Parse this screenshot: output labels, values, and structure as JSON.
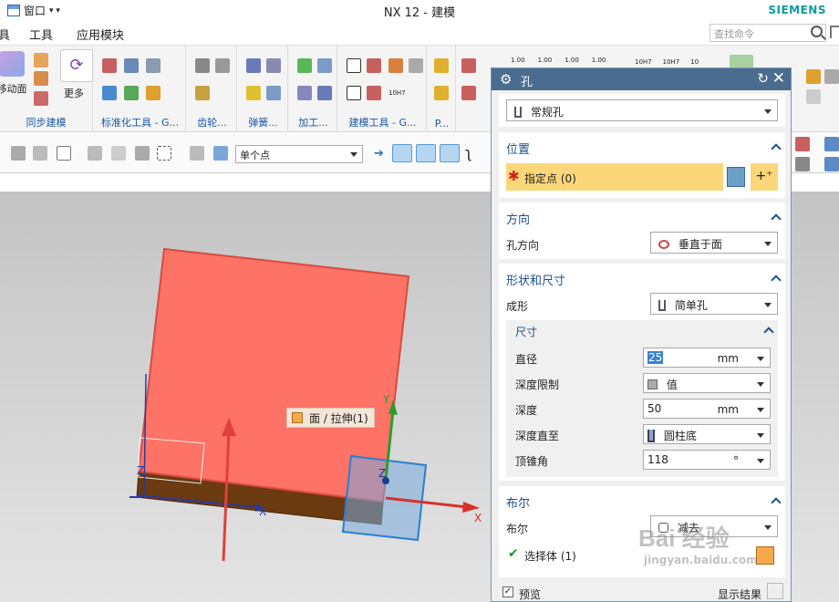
{
  "titlebar": {
    "window_menu": "窗口",
    "title": "NX 12 - 建模",
    "brand": "SIEMENS"
  },
  "menubar": {
    "items": [
      "具",
      "工具",
      "应用模块"
    ],
    "search_placeholder": "查找命令"
  },
  "ribbon": {
    "groups": [
      "同步建模",
      "标准化工具 - G...",
      "齿轮...",
      "弹簧...",
      "加工...",
      "建模工具 - G...",
      "P..."
    ],
    "move_face_label": "移动面",
    "more_label": "更多",
    "tolerance_labels": [
      "1.00",
      "1.00",
      "1.00",
      "1.00",
      "10H7",
      "10H7",
      "10"
    ],
    "small_label": "10H7"
  },
  "toolbar2": {
    "snap_filter": "单个点"
  },
  "viewport": {
    "tooltip": "面 / 拉伸(1)",
    "axis_labels": {
      "x1": "X",
      "x2": "X",
      "y": "Y",
      "z1": "Z",
      "z2": "Z"
    },
    "colors": {
      "face": "#ff7266",
      "side": "#6b3a10",
      "x_axis": "#d9302a",
      "y_axis": "#2e9b2e",
      "handle": "#2a7fd0"
    }
  },
  "dialog": {
    "title": "孔",
    "type_value": "常规孔",
    "location": {
      "header": "位置",
      "specify_point": "指定点 (0)"
    },
    "direction": {
      "header": "方向",
      "label": "孔方向",
      "value": "垂直于面"
    },
    "shape": {
      "header": "形状和尺寸",
      "form_label": "成形",
      "form_value": "简单孔"
    },
    "dims": {
      "header": "尺寸",
      "diameter_label": "直径",
      "diameter_value": "25",
      "diameter_unit": "mm",
      "depth_limit_label": "深度限制",
      "depth_limit_value": "值",
      "depth_label": "深度",
      "depth_value": "50",
      "depth_unit": "mm",
      "depth_to_label": "深度直至",
      "depth_to_value": "圆柱底",
      "tip_angle_label": "顶锥角",
      "tip_angle_value": "118",
      "tip_angle_unit": "°"
    },
    "boolean": {
      "header": "布尔",
      "label": "布尔",
      "value": "减去",
      "select_body": "选择体 (1)"
    },
    "footer": {
      "preview_label": "预览",
      "show_result_label": "显示结果"
    }
  },
  "watermark": {
    "text": "Bai 经验",
    "url": "jingyan.baidu.com"
  }
}
